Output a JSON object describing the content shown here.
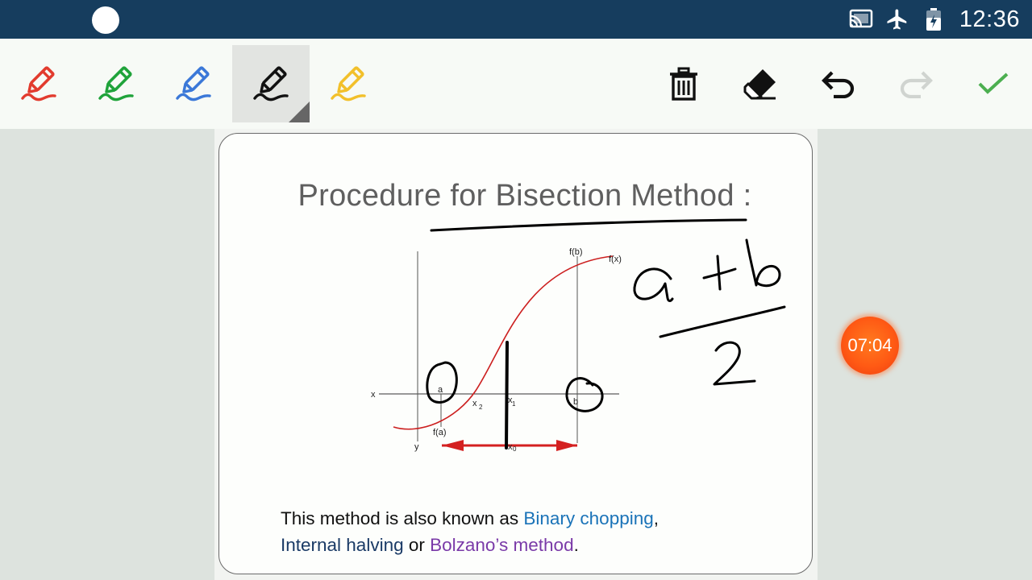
{
  "status_bar": {
    "time": "12:36",
    "icons": [
      "cast-icon",
      "airplane-mode-icon",
      "battery-icon"
    ]
  },
  "toolbar": {
    "pens": [
      {
        "name": "red-pen",
        "color": "#e23b2e"
      },
      {
        "name": "green-pen",
        "color": "#1fa33a"
      },
      {
        "name": "blue-pen",
        "color": "#3b78d8"
      },
      {
        "name": "black-pen",
        "color": "#111111",
        "selected": true
      },
      {
        "name": "yellow-pen",
        "color": "#f2c02b"
      }
    ],
    "actions": [
      "trash-icon",
      "eraser-icon",
      "undo-icon",
      "redo-icon",
      "check-icon"
    ],
    "colors": {
      "check": "#4caf50",
      "redo_disabled": "#d0d4d0"
    }
  },
  "slide": {
    "title": "Procedure for Bisection Method :",
    "figure_labels": {
      "fb": "f(b)",
      "fx": "f(x)",
      "x_axis": "x",
      "y_axis": "y",
      "a": "a",
      "b": "b",
      "x2": "x",
      "x2_sub": "2",
      "x1": "x",
      "x1_sub": "1",
      "x0": "x",
      "x0_sub": "0",
      "fa": "f(a)"
    },
    "caption": {
      "part1": "This method is also known as ",
      "link1": "Binary chopping",
      "part2": ",",
      "link2": "Internal halving",
      "part3": " or ",
      "link3": "Bolzano’s method",
      "part4": "."
    }
  },
  "timer": {
    "text": "07:04"
  }
}
